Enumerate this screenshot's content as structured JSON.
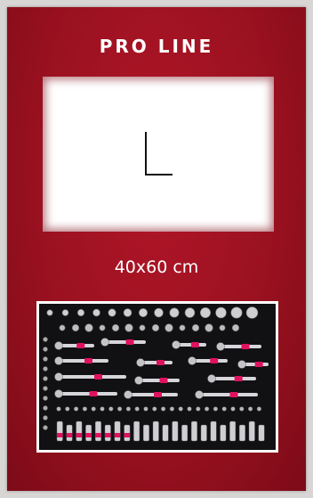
{
  "brand": {
    "name": "PRO LINE"
  },
  "size": {
    "letter": "L",
    "dimensions": "40x60 cm"
  },
  "tray_image": {
    "icon": "tool-tray-image"
  },
  "colors": {
    "background": "#9a1120",
    "accent": "#e0115f",
    "text": "#ffffff"
  }
}
